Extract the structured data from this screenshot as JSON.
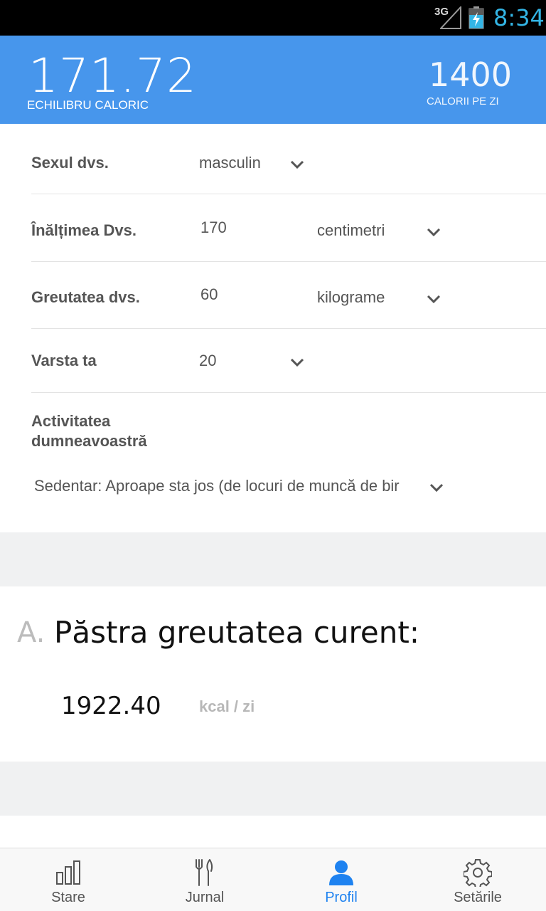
{
  "status_bar": {
    "network": "3G",
    "time": "8:34"
  },
  "header": {
    "balance_value": "171.72",
    "balance_label": "ECHILIBRU CALORIC",
    "daily_value": "1400",
    "daily_label": "CALORII PE ZI"
  },
  "profile": {
    "sex": {
      "label": "Sexul dvs.",
      "value": "masculin"
    },
    "height": {
      "label": "Înălțimea Dvs.",
      "value": "170",
      "unit": "centimetri"
    },
    "weight": {
      "label": "Greutatea dvs.",
      "value": "60",
      "unit": "kilograme"
    },
    "age": {
      "label": "Varsta ta",
      "value": "20"
    },
    "activity": {
      "label_line1": "Activitatea",
      "label_line2": "dumneavoastră",
      "value": "Sedentar: Aproape sta jos (de locuri de muncă de bir"
    }
  },
  "section_a": {
    "letter": "A.",
    "title": "Păstra greutatea curent:",
    "value": "1922.40",
    "unit": "kcal / zi"
  },
  "bottom_nav": {
    "items": [
      {
        "label": "Stare",
        "icon": "bar-chart-icon",
        "active": false
      },
      {
        "label": "Jurnal",
        "icon": "fork-knife-icon",
        "active": false
      },
      {
        "label": "Profil",
        "icon": "person-icon",
        "active": true
      },
      {
        "label": "Setările",
        "icon": "gear-icon",
        "active": false
      }
    ]
  },
  "colors": {
    "header_bg": "#4796ec",
    "active_tab": "#1e82f0",
    "status_time": "#33b5e5"
  }
}
